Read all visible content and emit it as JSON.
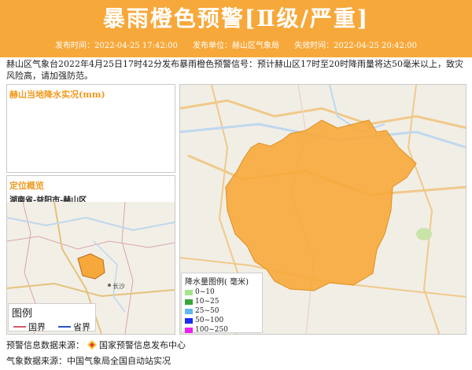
{
  "header": {
    "title": "暴雨橙色预警[Ⅱ级/严重]",
    "publish_time": "发布时间：2022-04-25 17:42:00",
    "publisher": "发布单位：赫山区气象局",
    "expire_time": "失效时间：2022-04-25 20:42:00"
  },
  "description": "赫山区气象台2022年4月25日17时42分发布暴雨橙色预警信号：预计赫山区17时至20时降雨量将达50毫米以上，致灾风险高，请加强防范。",
  "rain_panel": {
    "title": "赫山当地降水实况(mm)"
  },
  "location_panel": {
    "title": "定位概览",
    "region": "湖南省-益阳市-赫山区"
  },
  "map_labels": {
    "city": "长沙"
  },
  "rain_legend": {
    "title": "降水量图例( 毫米)",
    "items": [
      {
        "label": "0~10",
        "color": "#a6e38a"
      },
      {
        "label": "10~25",
        "color": "#39a53a"
      },
      {
        "label": "25~50",
        "color": "#60b8f0"
      },
      {
        "label": "50~100",
        "color": "#1a2ef0"
      },
      {
        "label": "100~250",
        "color": "#f01df0"
      }
    ]
  },
  "boundary_legend": {
    "title": "图例",
    "items": [
      {
        "label": "国界",
        "color": "#d45a6b"
      },
      {
        "label": "省界",
        "color": "#2a55c8"
      }
    ]
  },
  "footer": {
    "source1": "预警信息数据来源：",
    "source1_name": "国家预警信息发布中心",
    "source2": "气象数据来源：中国气象局全国自动站实况"
  }
}
